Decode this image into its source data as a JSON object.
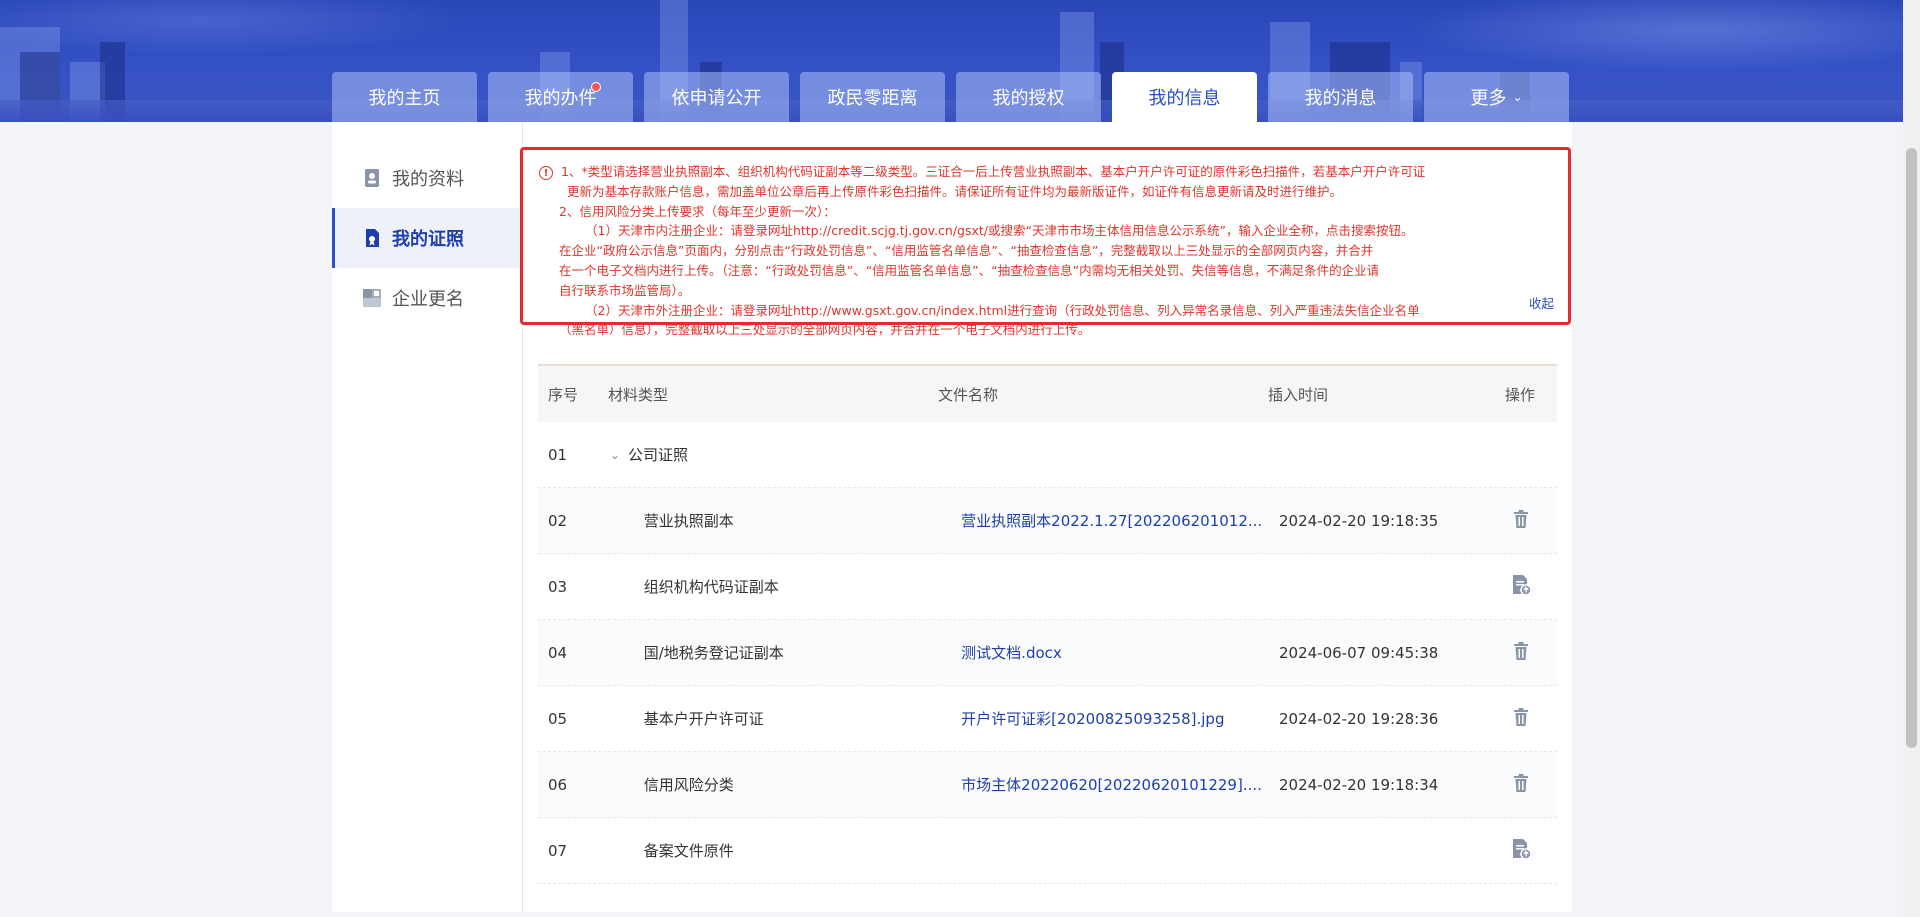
{
  "tabs": [
    {
      "label": "我的主页",
      "active": false,
      "badge": false
    },
    {
      "label": "我的办件",
      "active": false,
      "badge": true
    },
    {
      "label": "依申请公开",
      "active": false,
      "badge": false
    },
    {
      "label": "政民零距离",
      "active": false,
      "badge": false
    },
    {
      "label": "我的授权",
      "active": false,
      "badge": false
    },
    {
      "label": "我的信息",
      "active": true,
      "badge": false
    },
    {
      "label": "我的消息",
      "active": false,
      "badge": false
    },
    {
      "label": "更多",
      "active": false,
      "badge": false
    }
  ],
  "sidebar": {
    "items": [
      {
        "label": "我的资料",
        "icon": "profile-icon"
      },
      {
        "label": "我的证照",
        "icon": "certificate-icon",
        "active": true
      },
      {
        "label": "企业更名",
        "icon": "rename-icon"
      }
    ]
  },
  "notice": {
    "line1": "1、*类型请选择营业执照副本、组织机构代码证副本等二级类型。三证合一后上传营业执照副本、基本户开户许可证的原件彩色扫描件，若基本户开户许可证",
    "line1b": "更新为基本存款账户信息，需加盖单位公章后再上传原件彩色扫描件。请保证所有证件均为最新版证件，如证件有信息更新请及时进行维护。",
    "line2": "2、信用风险分类上传要求（每年至少更新一次）：",
    "line3": "（1）天津市内注册企业：请登录网址http://credit.scjg.tj.gov.cn/gsxt/或搜索“天津市市场主体信用信息公示系统”，输入企业全称，点击搜索按钮。",
    "line3b": "在企业“政府公示信息”页面内，分别点击“行政处罚信息”、“信用监管名单信息”、“抽查检查信息”，完整截取以上三处显示的全部网页内容，并合并",
    "line3c": "在一个电子文档内进行上传。（注意：“行政处罚信息”、“信用监管名单信息”、“抽查检查信息”内需均无相关处罚、失信等信息，不满足条件的企业请",
    "line3d": "自行联系市场监管局）。",
    "line4": "（2）天津市外注册企业：请登录网址http://www.gsxt.gov.cn/index.html进行查询（行政处罚信息、列入异常名录信息、列入严重违法失信企业名单",
    "line4b": "（黑名单）信息），完整截取以上三处显示的全部网页内容，并合并在一个电子文档内进行上传。",
    "collapse": "收起"
  },
  "table": {
    "headers": {
      "no": "序号",
      "type": "材料类型",
      "file": "文件名称",
      "time": "插入时间",
      "op": "操作"
    },
    "rows": [
      {
        "no": "01",
        "type": "公司证照",
        "group": true,
        "file": "",
        "time": "",
        "op": ""
      },
      {
        "no": "02",
        "type": "营业执照副本",
        "file": "营业执照副本2022.1.27[202206201012...",
        "time": "2024-02-20 19:18:35",
        "op": "delete"
      },
      {
        "no": "03",
        "type": "组织机构代码证副本",
        "file": "",
        "time": "",
        "op": "upload"
      },
      {
        "no": "04",
        "type": "国/地税务登记证副本",
        "file": "测试文档.docx",
        "time": "2024-06-07 09:45:38",
        "op": "delete"
      },
      {
        "no": "05",
        "type": "基本户开户许可证",
        "file": "开户许可证彩[20200825093258].jpg",
        "time": "2024-02-20 19:28:36",
        "op": "delete"
      },
      {
        "no": "06",
        "type": "信用风险分类",
        "file": "市场主体20220620[20220620101229]....",
        "time": "2024-02-20 19:18:34",
        "op": "delete"
      },
      {
        "no": "07",
        "type": "备案文件原件",
        "file": "",
        "time": "",
        "op": "upload"
      }
    ]
  },
  "colors": {
    "accent": "#2d4fc4",
    "notice_red": "#e0352b",
    "link": "#1f3fa8"
  }
}
